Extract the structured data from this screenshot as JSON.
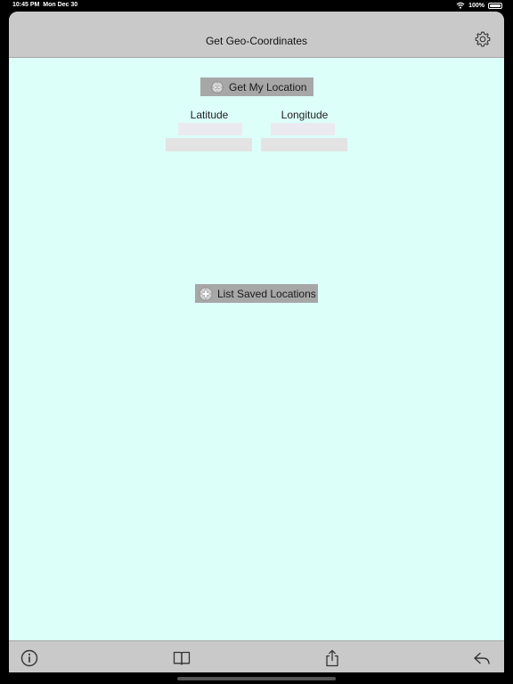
{
  "status_bar": {
    "time": "10:45 PM",
    "date": "Mon Dec 30",
    "battery": "100%"
  },
  "nav": {
    "title": "Get Geo-Coordinates",
    "settings_icon": "gear-icon"
  },
  "main": {
    "get_location_label": "Get My Location",
    "latitude_label": "Latitude",
    "longitude_label": "Longitude",
    "latitude_value": "",
    "longitude_value": "",
    "latitude_detail": "",
    "longitude_detail": "",
    "list_saved_label": "List Saved Locations"
  },
  "toolbar": {
    "items": [
      "info-icon",
      "book-icon",
      "share-icon",
      "reply-icon"
    ]
  },
  "colors": {
    "background": "#dcfffa",
    "bars": "#c9c9c9",
    "button": "#a7a7a7"
  }
}
